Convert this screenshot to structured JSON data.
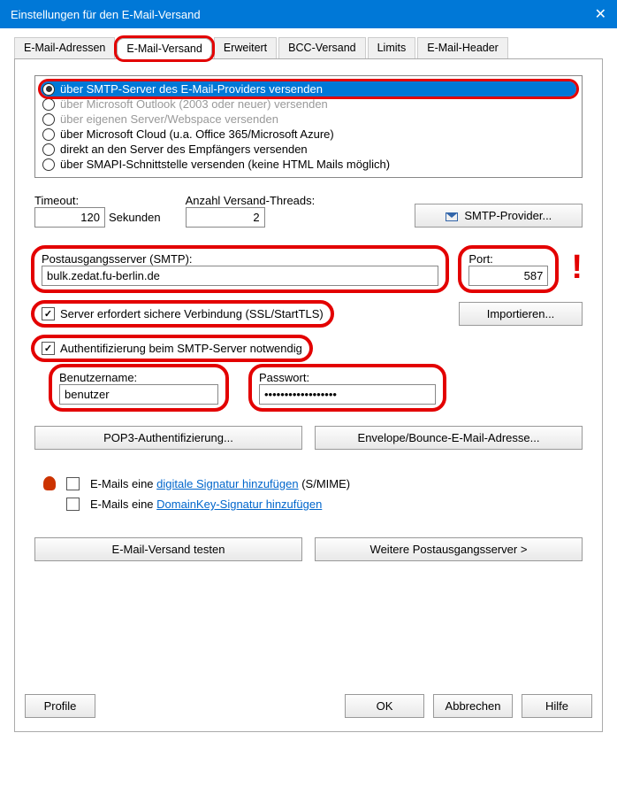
{
  "titlebar": {
    "title": "Einstellungen für den E-Mail-Versand"
  },
  "tabs": {
    "items": [
      "E-Mail-Adressen",
      "E-Mail-Versand",
      "Erweitert",
      "BCC-Versand",
      "Limits",
      "E-Mail-Header"
    ],
    "active_index": 1,
    "highlighted_index": 1
  },
  "radios": {
    "options": [
      "über SMTP-Server des E-Mail-Providers versenden",
      "über Microsoft Outlook (2003 oder neuer) versenden",
      "über eigenen Server/Webspace versenden",
      "über Microsoft Cloud (u.a. Office 365/Microsoft Azure)",
      "direkt an den Server des Empfängers versenden",
      "über SMAPI-Schnittstelle versenden (keine HTML Mails möglich)"
    ],
    "selected_index": 0
  },
  "timeout": {
    "label": "Timeout:",
    "value": "120",
    "unit": "Sekunden"
  },
  "threads": {
    "label": "Anzahl Versand-Threads:",
    "value": "2"
  },
  "smtp_provider_btn": "SMTP-Provider...",
  "smtp": {
    "label": "Postausgangsserver (SMTP):",
    "value": "bulk.zedat.fu-berlin.de"
  },
  "port": {
    "label": "Port:",
    "value": "587"
  },
  "ssl": {
    "label": "Server erfordert sichere Verbindung (SSL/StartTLS)",
    "checked": true
  },
  "import_btn": "Importieren...",
  "auth": {
    "label": "Authentifizierung beim SMTP-Server notwendig",
    "checked": true
  },
  "username": {
    "label": "Benutzername:",
    "value": "benutzer"
  },
  "password": {
    "label": "Passwort:",
    "value": "••••••••••••••••••"
  },
  "pop3_btn": "POP3-Authentifizierung...",
  "envelope_btn": "Envelope/Bounce-E-Mail-Adresse...",
  "smime": {
    "prefix": "E-Mails eine ",
    "link": "digitale Signatur hinzufügen",
    "suffix": " (S/MIME)",
    "checked": false
  },
  "domainkey": {
    "prefix": "E-Mails eine ",
    "link": "DomainKey-Signatur hinzufügen",
    "checked": false
  },
  "test_btn": "E-Mail-Versand testen",
  "more_servers_btn": "Weitere Postausgangsserver >",
  "footer": {
    "profile": "Profile",
    "ok": "OK",
    "cancel": "Abbrechen",
    "help": "Hilfe"
  }
}
